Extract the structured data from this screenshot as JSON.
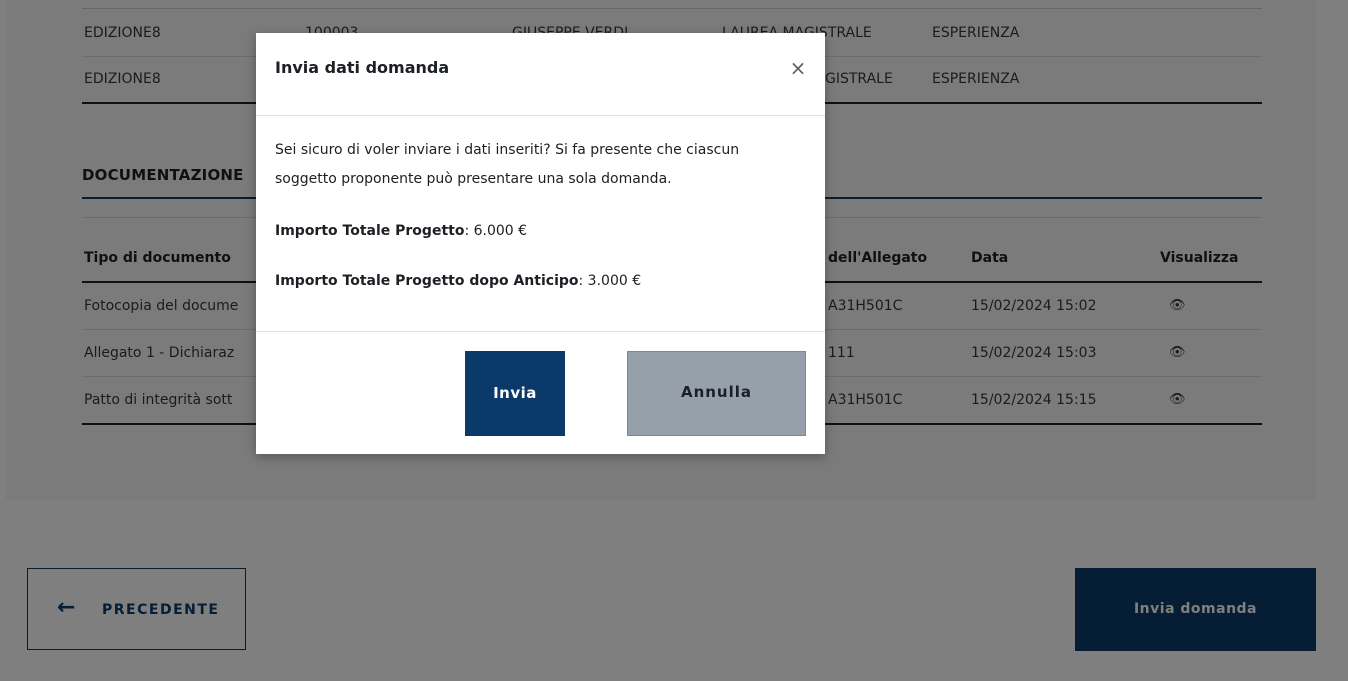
{
  "applicants_table": {
    "rows": [
      [
        "EDIZIONE8",
        "100003",
        "GIUSEPPE VERDI",
        "LAUREA MAGISTRALE",
        "ESPERIENZA"
      ],
      [
        "EDIZIONE8",
        "",
        "",
        "",
        "ESPERIENZA"
      ]
    ],
    "row_partial_magistrale": "GISTRALE"
  },
  "documentation": {
    "title": "DOCUMENTAZIONE",
    "headers": {
      "tipo": "Tipo di documento",
      "allegato": "dell'Allegato",
      "data": "Data",
      "visualizza": "Visualizza"
    },
    "rows": [
      {
        "tipo": "Fotocopia del docume",
        "allegato": "A31H501C",
        "data": "15/02/2024 15:02",
        "icon": "eye-icon"
      },
      {
        "tipo": "Allegato 1 - Dichiaraz",
        "allegato": "111",
        "data": "15/02/2024 15:03",
        "icon": "eye-icon"
      },
      {
        "tipo": "Patto di integrità sott",
        "allegato": "A31H501C",
        "data": "15/02/2024 15:15",
        "icon": "eye-icon"
      }
    ]
  },
  "nav": {
    "prev_label": "PRECEDENTE",
    "prev_icon": "arrow-left-icon",
    "submit_label": "Invia domanda"
  },
  "modal": {
    "title": "Invia dati domanda",
    "close_glyph": "×",
    "message": "Sei sicuro di voler inviare i dati inseriti? Si fa presente che ciascun soggetto proponente può presentare una sola domanda.",
    "importo_label": "Importo Totale Progetto",
    "importo_value": ": 6.000 €",
    "anticipo_label": "Importo Totale Progetto dopo Anticipo",
    "anticipo_value": ": 3.000 €",
    "confirm_label": "Invia",
    "cancel_label": "Annulla"
  },
  "colors": {
    "primary": "#0b3a6a",
    "cancel_bg": "#96a0ab",
    "overlay": "rgba(0,0,0,0.5)"
  }
}
